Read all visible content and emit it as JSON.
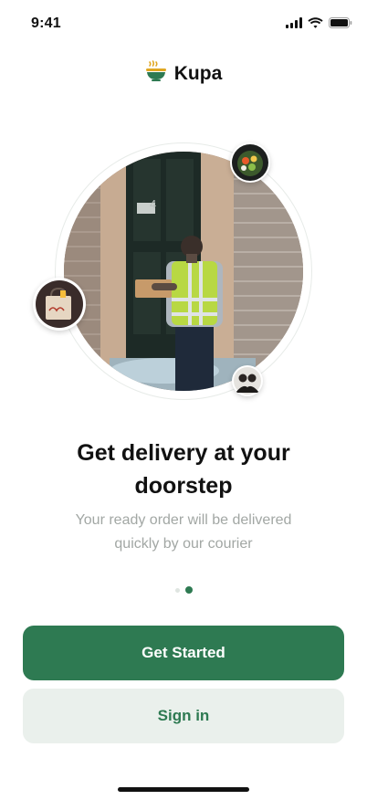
{
  "status_bar": {
    "time": "9:41"
  },
  "brand": {
    "name": "Kupa"
  },
  "onboarding": {
    "headline": "Get delivery at your doorstep",
    "subtitle": "Your ready order will be delivered quickly by our courier",
    "page_index": 2,
    "page_count": 2,
    "door_number": "4"
  },
  "actions": {
    "primary_label": "Get Started",
    "secondary_label": "Sign in"
  },
  "colors": {
    "accent": "#2e7a52",
    "accent_light": "#eaf0ec"
  }
}
